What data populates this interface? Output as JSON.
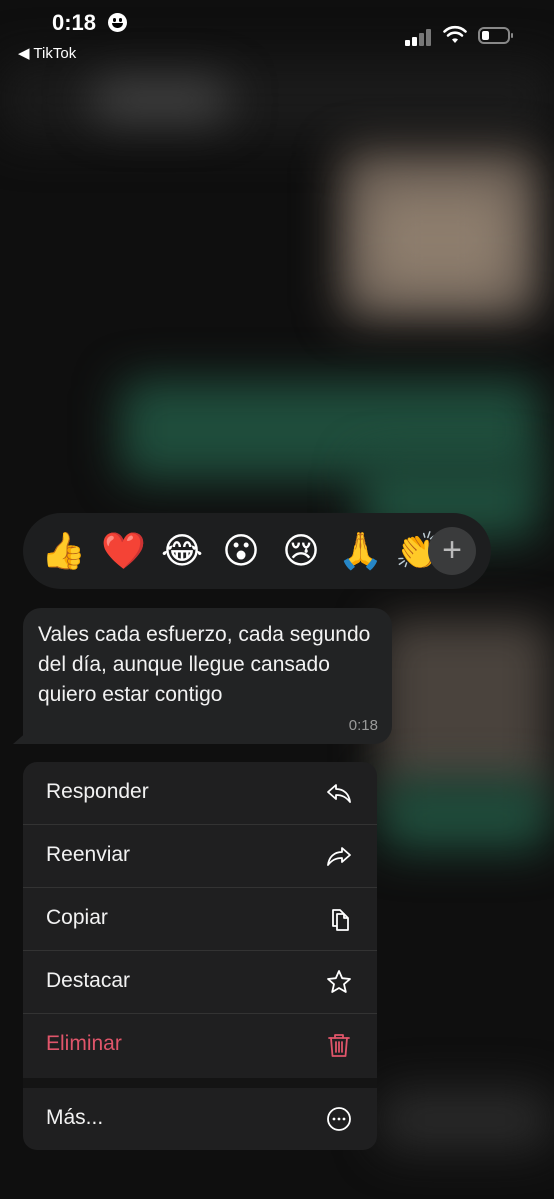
{
  "status_bar": {
    "time": "0:18",
    "back_label": "◀ TikTok"
  },
  "reactions": {
    "emojis": [
      "👍",
      "❤️",
      "😂",
      "😮",
      "😢",
      "🙏",
      "👏"
    ],
    "more_label": "+"
  },
  "message": {
    "text": "Vales cada esfuerzo, cada segundo del día, aunque llegue cansado quiero estar contigo",
    "time": "0:18"
  },
  "menu": {
    "items": [
      {
        "label": "Responder",
        "icon": "reply-icon"
      },
      {
        "label": "Reenviar",
        "icon": "forward-icon"
      },
      {
        "label": "Copiar",
        "icon": "copy-icon"
      },
      {
        "label": "Destacar",
        "icon": "star-icon"
      },
      {
        "label": "Eliminar",
        "icon": "trash-icon"
      },
      {
        "label": "Más...",
        "icon": "more-icon"
      }
    ]
  },
  "colors": {
    "danger": "#e0556a",
    "bubble": "#222324",
    "menu": "#1f1f20"
  }
}
